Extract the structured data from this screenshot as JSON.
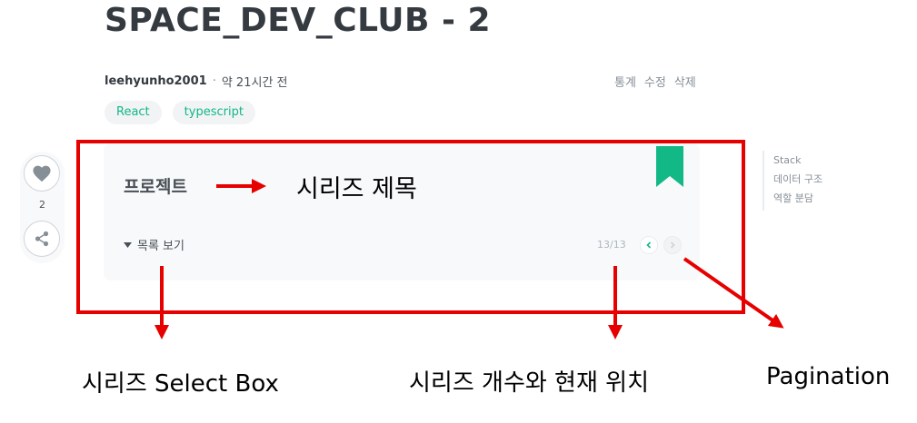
{
  "post": {
    "title": "SPACE_DEV_CLUB - 2",
    "author": "leehyunho2001",
    "separator": "·",
    "date": "약 21시간 전",
    "actions": [
      "통계",
      "수정",
      "삭제"
    ],
    "tags": [
      "React",
      "typescript"
    ]
  },
  "like": {
    "count": "2",
    "like_icon": "heart-icon",
    "share_icon": "share-icon"
  },
  "series": {
    "title": "프로젝트",
    "list_toggle_label": "목록 보기",
    "counter": "13/13",
    "bookmark_icon": "bookmark-icon",
    "prev_icon": "chevron-left-icon",
    "next_icon": "chevron-right-icon"
  },
  "toc": {
    "items": [
      "Stack",
      "데이터 구조",
      "역할 분담"
    ]
  },
  "annotations": {
    "series_title": "시리즈 제목",
    "select_box": "시리즈 Select Box",
    "count_position": "시리즈 개수와 현재 위치",
    "pagination": "Pagination"
  },
  "colors": {
    "accent": "#12b886",
    "annotation_red": "#e60000",
    "series_bg": "#f8f9fa"
  }
}
